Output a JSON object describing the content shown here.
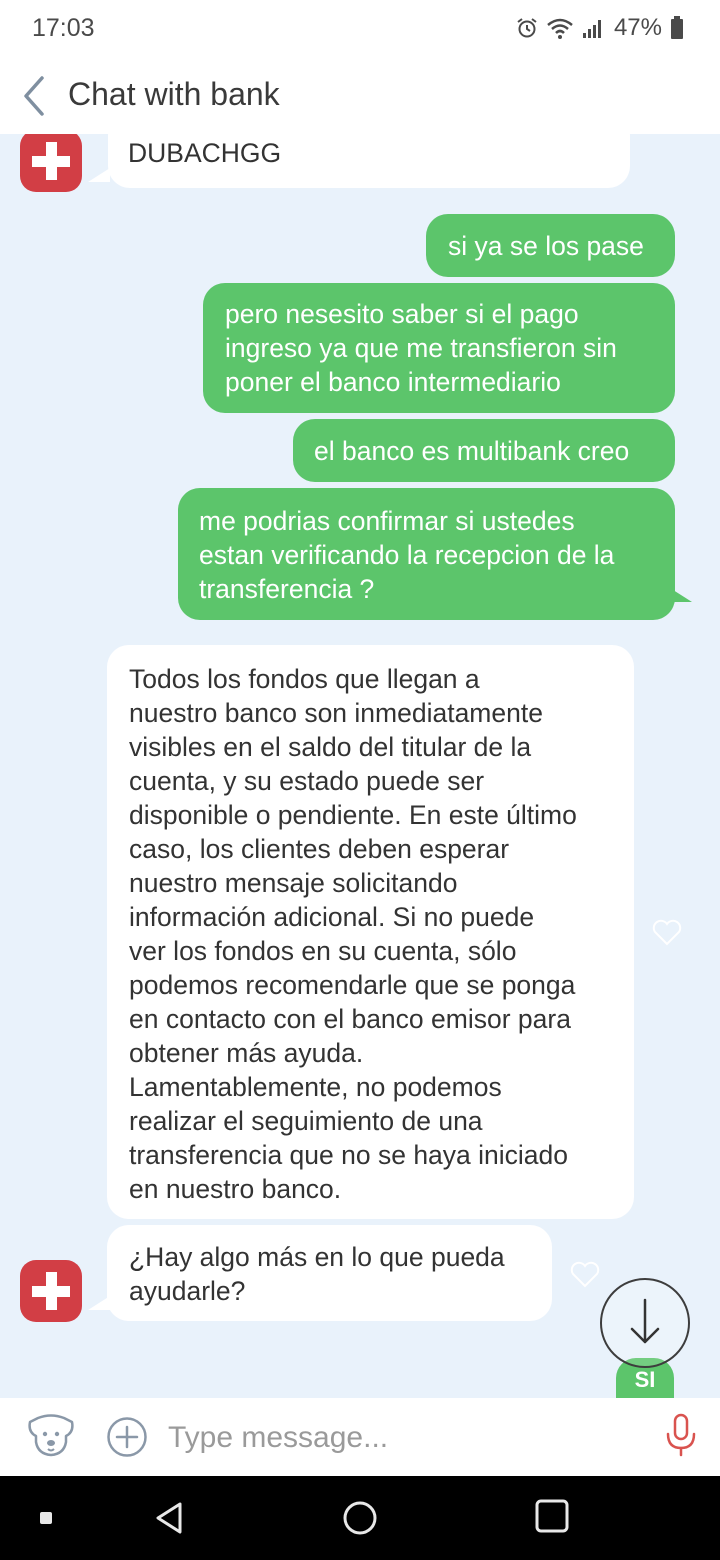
{
  "status_bar": {
    "time": "17:03",
    "battery_percent": "47%",
    "icons": [
      "alarm-icon",
      "wifi-icon",
      "signal-icon",
      "battery-icon"
    ]
  },
  "app_bar": {
    "back_icon": "chevron-left-icon",
    "title": "Chat with bank"
  },
  "messages": [
    {
      "side": "in",
      "text": "DUBACHGG",
      "avatar": "swiss-cross-avatar"
    },
    {
      "side": "out",
      "text": "si ya se los pase"
    },
    {
      "side": "out",
      "line1": "pero nesesito saber si el pago",
      "line2": "ingreso ya que me transfieron sin",
      "line3": "poner el banco intermediario"
    },
    {
      "side": "out",
      "text": "el banco es multibank creo"
    },
    {
      "side": "out",
      "line1": "me podrias confirmar si ustedes",
      "line2": "estan verificando la recepcion de la",
      "line3": "transferencia ?"
    },
    {
      "side": "in",
      "lines": [
        "Todos los fondos que llegan a",
        "nuestro banco son inmediatamente",
        "visibles en el saldo del titular de la",
        "cuenta, y su estado puede ser",
        "disponible o pendiente. En este último",
        "caso, los clientes deben esperar",
        "nuestro mensaje solicitando",
        "información adicional. Si no puede",
        "ver los fondos en su cuenta, sólo",
        "podemos recomendarle que se ponga",
        "en contacto con el banco emisor para",
        "obtener más ayuda.",
        "Lamentablemente, no podemos",
        "realizar el seguimiento de una",
        "transferencia que no se haya iniciado",
        "en nuestro banco."
      ]
    },
    {
      "side": "in",
      "line1": "¿Hay algo más en lo que pueda",
      "line2": "ayudarle?",
      "avatar": "swiss-cross-avatar"
    }
  ],
  "quick_reply": {
    "label": "SI"
  },
  "scroll_button": {
    "icon": "arrow-down-icon"
  },
  "input_bar": {
    "placeholder": "Type message...",
    "dog_icon": "dog-icon",
    "plus_icon": "plus-circle-icon",
    "mic_icon": "microphone-icon"
  },
  "colors": {
    "chat_background": "#e9f2fb",
    "outgoing_bubble": "#5cc56b",
    "incoming_bubble": "#ffffff",
    "avatar_red": "#d23e45",
    "mic_red": "#d9534f"
  }
}
